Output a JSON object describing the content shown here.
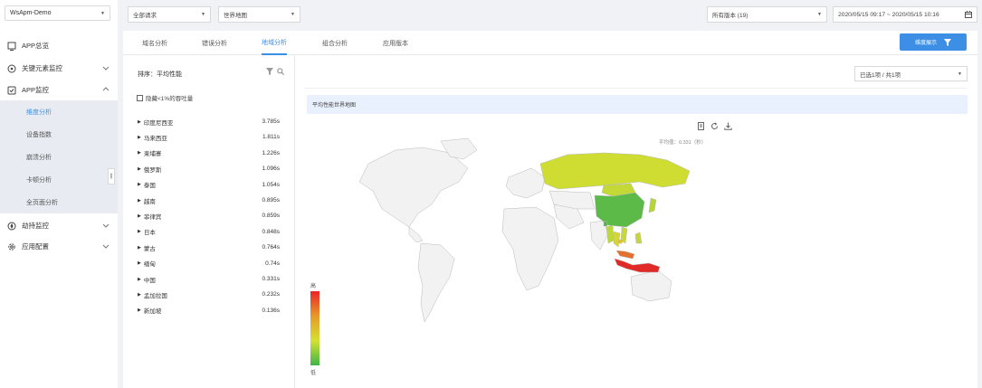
{
  "app_select": {
    "value": "WsApm-Demo"
  },
  "sidebar": {
    "items": [
      {
        "label": "APP总览",
        "icon": "dashboard-icon"
      },
      {
        "label": "关键元素监控",
        "icon": "target-icon"
      },
      {
        "label": "APP监控",
        "icon": "monitor-icon"
      },
      {
        "label": "劫持监控",
        "icon": "hijack-icon"
      },
      {
        "label": "应用配置",
        "icon": "settings-icon"
      }
    ],
    "sub_items": [
      {
        "label": "维度分析",
        "active": true
      },
      {
        "label": "设备指数",
        "active": false
      },
      {
        "label": "崩溃分析",
        "active": false
      },
      {
        "label": "卡顿分析",
        "active": false
      },
      {
        "label": "全页面分析",
        "active": false
      }
    ],
    "collapse_label": "||"
  },
  "topbar": {
    "request_filter": "全部请求",
    "map_type": "世界地图",
    "version_filter": "所有版本 (19)",
    "date_range": "2020/05/15 09:17 ~ 2020/05/15 10:16"
  },
  "tabs": [
    {
      "label": "域名分析",
      "active": false
    },
    {
      "label": "错误分析",
      "active": false
    },
    {
      "label": "地域分析",
      "active": true
    },
    {
      "label": "组合分析",
      "active": false
    },
    {
      "label": "应用版本",
      "active": false
    }
  ],
  "dimension_button": "维度展示",
  "left_panel": {
    "sort_label": "排序：平均性能",
    "hide_label": "隐藏<1%的吞吐量",
    "rows": [
      {
        "country": "印度尼西亚",
        "value": "3.785s"
      },
      {
        "country": "马来西亚",
        "value": "1.811s"
      },
      {
        "country": "柬埔寨",
        "value": "1.226s"
      },
      {
        "country": "俄罗斯",
        "value": "1.096s"
      },
      {
        "country": "泰国",
        "value": "1.054s"
      },
      {
        "country": "越南",
        "value": "0.895s"
      },
      {
        "country": "菲律宾",
        "value": "0.859s"
      },
      {
        "country": "日本",
        "value": "0.848s"
      },
      {
        "country": "蒙古",
        "value": "0.764s"
      },
      {
        "country": "缅甸",
        "value": "0.74s"
      },
      {
        "country": "中国",
        "value": "0.331s"
      },
      {
        "country": "孟加拉国",
        "value": "0.232s"
      },
      {
        "country": "新加坡",
        "value": "0.136s"
      }
    ]
  },
  "right_panel": {
    "selection": "已选1项 / 共1项",
    "map_title": "平均性能世界地图",
    "average_label": "平均值：0.331（秒）",
    "legend_high": "高",
    "legend_low": "低"
  },
  "colors": {
    "accent": "#3d8fe6",
    "high": "#e8262a",
    "mid": "#d6e034",
    "low": "#3fb549"
  }
}
